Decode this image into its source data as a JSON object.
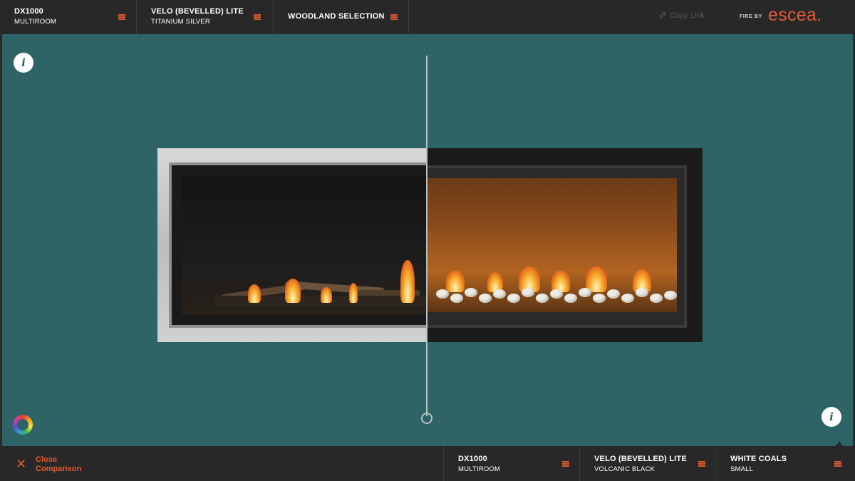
{
  "top": {
    "selectors": [
      {
        "title": "DX1000",
        "subtitle": "MULTIROOM"
      },
      {
        "title": "VELO (BEVELLED) LITE",
        "subtitle": "TITANIUM SILVER"
      },
      {
        "title": "WOODLAND SELECTION",
        "subtitle": ""
      }
    ],
    "copy_link": "Copy Link",
    "brand_prefix": "FIRE BY",
    "brand_logo": "escea."
  },
  "viewer": {
    "info_icon": "i",
    "split_position_percent": 50
  },
  "bottom": {
    "close_label": "Close\nComparison",
    "selectors": [
      {
        "title": "DX1000",
        "subtitle": "MULTIROOM"
      },
      {
        "title": "VELO (BEVELLED) LITE",
        "subtitle": "VOLCANIC BLACK"
      },
      {
        "title": "WHITE COALS",
        "subtitle": "SMALL"
      }
    ]
  },
  "colors": {
    "accent": "#e35b34",
    "background": "#2e6465",
    "bar": "#282828"
  },
  "icons": [
    "menu-icon",
    "link-icon",
    "info-icon",
    "color-wheel-icon",
    "close-icon",
    "split-handle-icon"
  ]
}
